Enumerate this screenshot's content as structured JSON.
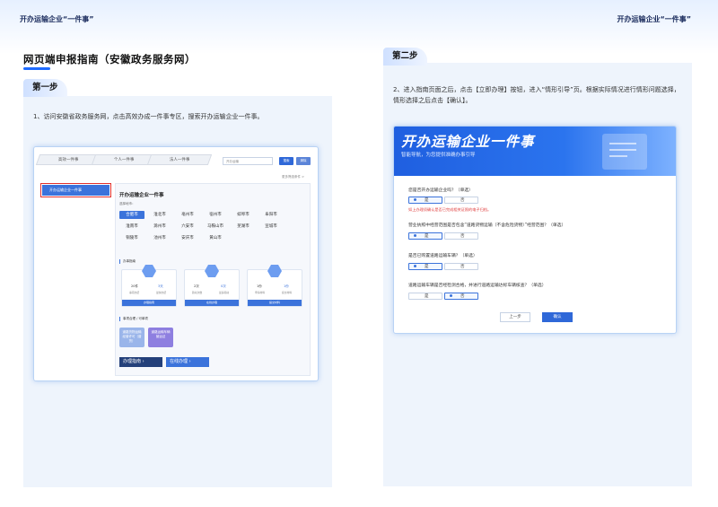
{
  "running_header": {
    "left": "开办运输企业“一件事”",
    "right": "开办运输企业“一件事”"
  },
  "main_title": "网页端申报指南（安徽政务服务网）",
  "step1": {
    "tab": "第一步",
    "text": "1、访问安徽省政务服务网，点击高效办成一件事专区，搜索开办运输企业一件事。",
    "screenshot": {
      "tabs": [
        "高效一件事",
        "个人一件事",
        "法人一件事"
      ],
      "search_placeholder": "开办运输",
      "search_button": "搜索",
      "clear_button": "清除",
      "lang_link": "更多筛选条件 >",
      "sidebar_item": "开办运输企业一件事",
      "heading": "开办运输企业一件事",
      "region_label": "选择地市：",
      "cities": [
        "合肥市",
        "淮北市",
        "亳州市",
        "宿州市",
        "蚌埠市",
        "阜阳市",
        "淮南市",
        "滁州市",
        "六安市",
        "马鞍山市",
        "芜湖市",
        "宣城市",
        "铜陵市",
        "池州市",
        "安庆市",
        "黄山市"
      ],
      "selected_city": "合肥市",
      "section_handle": "办事指南",
      "cards": [
        {
          "left": "20件",
          "right": "3天",
          "left_label": "事项办结",
          "right_label": "最快办结",
          "bar": "办理指南"
        },
        {
          "left": "2次",
          "right": "0次",
          "left_label": "跑动次数",
          "right_label": "最多跑动",
          "bar": "在线办理"
        },
        {
          "left": "1份",
          "right": "1份",
          "left_label": "申请材料",
          "right_label": "提交材料",
          "bar": "提交材料"
        }
      ],
      "section_combo": "事项合理 / 可单项",
      "tiles": [
        "道路货物运输经营许可（普货）",
        "道路运输车辆营运证"
      ],
      "guide_button": "办理指南",
      "online_button": "在线办理"
    }
  },
  "step2": {
    "tab": "第二步",
    "text": "2、进入指南页面之后，点击【立即办理】按钮，进入“情形引导”页。根据实际情况进行情形问题选择，情形选择之后点击【确认】。",
    "screenshot": {
      "banner_title": "开办运输企业一件事",
      "banner_subtitle": "智能导航，为您提供准确办事引导",
      "questions": [
        {
          "q": "您是否开办运输企业吗？（单选）",
          "options": [
            "是",
            "否"
          ],
          "selected": 0
        },
        {
          "q": "营业执照中经营范围是否包含“道路货物运输（不含危险货物）”经营范围？（单选）",
          "options": [
            "是",
            "否"
          ],
          "selected": 0
        },
        {
          "q": "是否已购置道路运输车辆？（单选）",
          "options": [
            "是",
            "否"
          ],
          "selected": 0
        },
        {
          "q": "道路运输车辆是否经检测合格，并进行道路运输达标车辆核查？（单选）",
          "options": [
            "是",
            "否"
          ],
          "selected": 1
        }
      ],
      "warning": "如上办理须确认是否已完成相关证照的电子归档。",
      "prev_button": "上一步",
      "confirm_button": "确认"
    }
  }
}
